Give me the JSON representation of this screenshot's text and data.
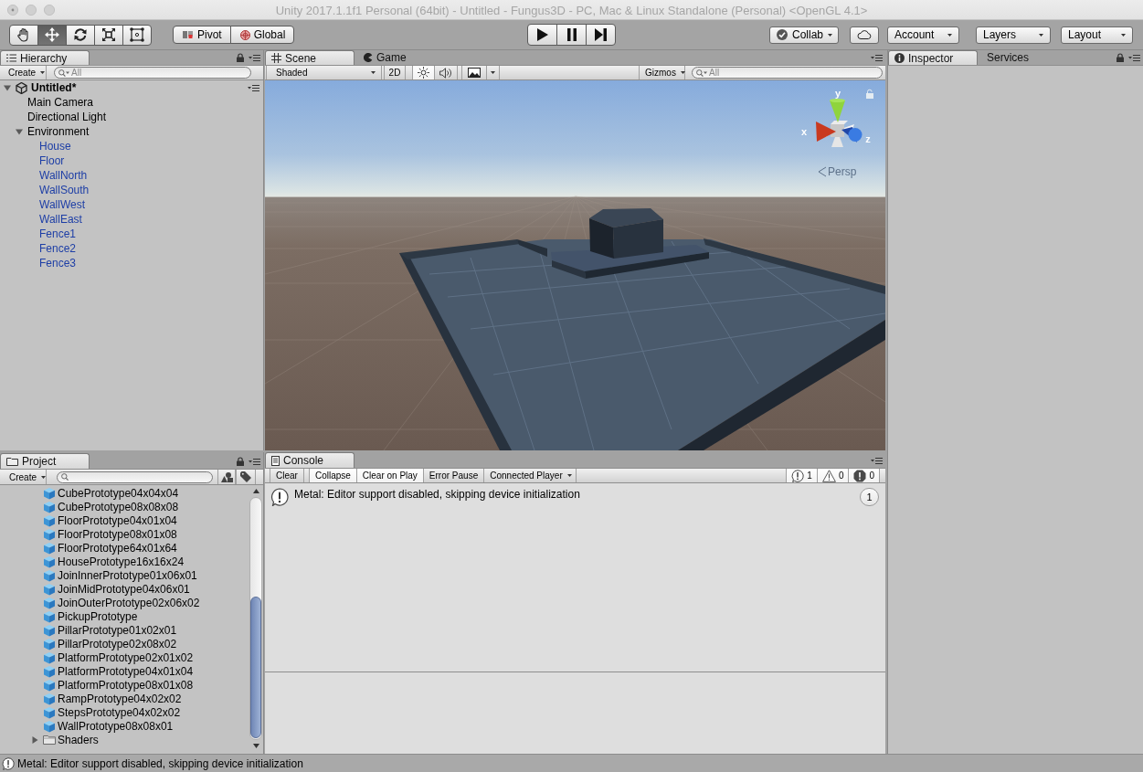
{
  "window": {
    "title": "Unity 2017.1.1f1 Personal (64bit) - Untitled - Fungus3D - PC, Mac & Linux Standalone (Personal) <OpenGL 4.1>"
  },
  "toolbar": {
    "tools": [
      {
        "kind": "hand",
        "selected": false
      },
      {
        "kind": "move",
        "selected": true
      },
      {
        "kind": "rotate",
        "selected": false
      },
      {
        "kind": "scale",
        "selected": false
      },
      {
        "kind": "rect",
        "selected": false
      }
    ],
    "pivot": "Pivot",
    "space": "Global",
    "playback": [
      {
        "kind": "play"
      },
      {
        "kind": "pause"
      },
      {
        "kind": "step"
      }
    ],
    "collab": "Collab",
    "account": "Account",
    "layers": "Layers",
    "layout": "Layout"
  },
  "hierarchy": {
    "tabs": [
      {
        "label": "Hierarchy",
        "kind": "hierarchy",
        "selected": true
      }
    ],
    "create": "Create",
    "search": {
      "placeholder": "All"
    },
    "tree": [
      {
        "label": "Untitled*",
        "kind": "scene",
        "expanded": true,
        "children": [
          {
            "label": "Main Camera",
            "kind": "object"
          },
          {
            "label": "Directional Light",
            "kind": "object"
          },
          {
            "label": "Environment",
            "kind": "object",
            "expanded": true,
            "children": [
              {
                "label": "House",
                "kind": "prefab_instance"
              },
              {
                "label": "Floor",
                "kind": "prefab_instance"
              },
              {
                "label": "WallNorth",
                "kind": "prefab_instance"
              },
              {
                "label": "WallSouth",
                "kind": "prefab_instance"
              },
              {
                "label": "WallWest",
                "kind": "prefab_instance"
              },
              {
                "label": "WallEast",
                "kind": "prefab_instance"
              },
              {
                "label": "Fence1",
                "kind": "prefab_instance"
              },
              {
                "label": "Fence2",
                "kind": "prefab_instance"
              },
              {
                "label": "Fence3",
                "kind": "prefab_instance"
              }
            ]
          }
        ]
      }
    ]
  },
  "scene": {
    "tabs": [
      {
        "label": "Scene",
        "kind": "scene",
        "selected": true
      },
      {
        "label": "Game",
        "kind": "game",
        "selected": false
      }
    ],
    "draw_mode": "Shaded",
    "toggles": [
      {
        "kind": "dimension",
        "label": "2D",
        "on": false
      },
      {
        "kind": "lighting",
        "on": true
      },
      {
        "kind": "audio",
        "on": false
      },
      {
        "kind": "effects",
        "on": false
      }
    ],
    "gizmos": "Gizmos",
    "search": {
      "placeholder": "All"
    },
    "axis_labels": [
      {
        "kind": "up",
        "label": "y"
      },
      {
        "kind": "left",
        "label": "x"
      },
      {
        "kind": "right",
        "label": "z"
      }
    ],
    "projection": "Persp"
  },
  "inspector": {
    "tabs": [
      {
        "label": "Inspector",
        "kind": "inspector",
        "selected": true
      },
      {
        "label": "Services",
        "kind": "plain",
        "selected": false
      }
    ]
  },
  "project": {
    "tabs": [
      {
        "label": "Project",
        "kind": "project",
        "selected": true
      }
    ],
    "create": "Create",
    "tree": [
      {
        "children": [
          {
            "label": "CubePrototype04x04x04",
            "kind": "prefab"
          },
          {
            "label": "CubePrototype08x08x08",
            "kind": "prefab"
          },
          {
            "label": "FloorPrototype04x01x04",
            "kind": "prefab"
          },
          {
            "label": "FloorPrototype08x01x08",
            "kind": "prefab"
          },
          {
            "label": "FloorPrototype64x01x64",
            "kind": "prefab"
          },
          {
            "label": "HousePrototype16x16x24",
            "kind": "prefab"
          },
          {
            "label": "JoinInnerPrototype01x06x01",
            "kind": "prefab"
          },
          {
            "label": "JoinMidPrototype04x06x01",
            "kind": "prefab"
          },
          {
            "label": "JoinOuterPrototype02x06x02",
            "kind": "prefab"
          },
          {
            "label": "PickupPrototype",
            "kind": "prefab"
          },
          {
            "label": "PillarPrototype01x02x01",
            "kind": "prefab"
          },
          {
            "label": "PillarPrototype02x08x02",
            "kind": "prefab"
          },
          {
            "label": "PlatformPrototype02x01x02",
            "kind": "prefab"
          },
          {
            "label": "PlatformPrototype04x01x04",
            "kind": "prefab"
          },
          {
            "label": "PlatformPrototype08x01x08",
            "kind": "prefab"
          },
          {
            "label": "RampPrototype04x02x02",
            "kind": "prefab"
          },
          {
            "label": "StepsPrototype04x02x02",
            "kind": "prefab"
          },
          {
            "label": "WallPrototype08x08x01",
            "kind": "prefab"
          }
        ]
      },
      {
        "label": "Shaders",
        "kind": "folder",
        "expanded": false
      }
    ]
  },
  "console": {
    "tabs": [
      {
        "label": "Console",
        "kind": "console",
        "selected": true
      }
    ],
    "clear": "Clear",
    "toggles": [
      {
        "label": "Collapse",
        "on": true
      },
      {
        "label": "Clear on Play",
        "on": true
      },
      {
        "label": "Error Pause",
        "on": false
      }
    ],
    "player": "Connected Player",
    "counters": [
      {
        "kind": "info",
        "count": "1",
        "on": true
      },
      {
        "kind": "warning",
        "count": "0",
        "on": true
      },
      {
        "kind": "error",
        "count": "0",
        "on": true
      }
    ],
    "messages": [
      {
        "kind": "info",
        "text": "Metal: Editor support disabled, skipping device initialization",
        "count": "1"
      }
    ]
  },
  "status_bar": {
    "kind": "info",
    "text": "Metal: Editor support disabled, skipping device initialization"
  }
}
